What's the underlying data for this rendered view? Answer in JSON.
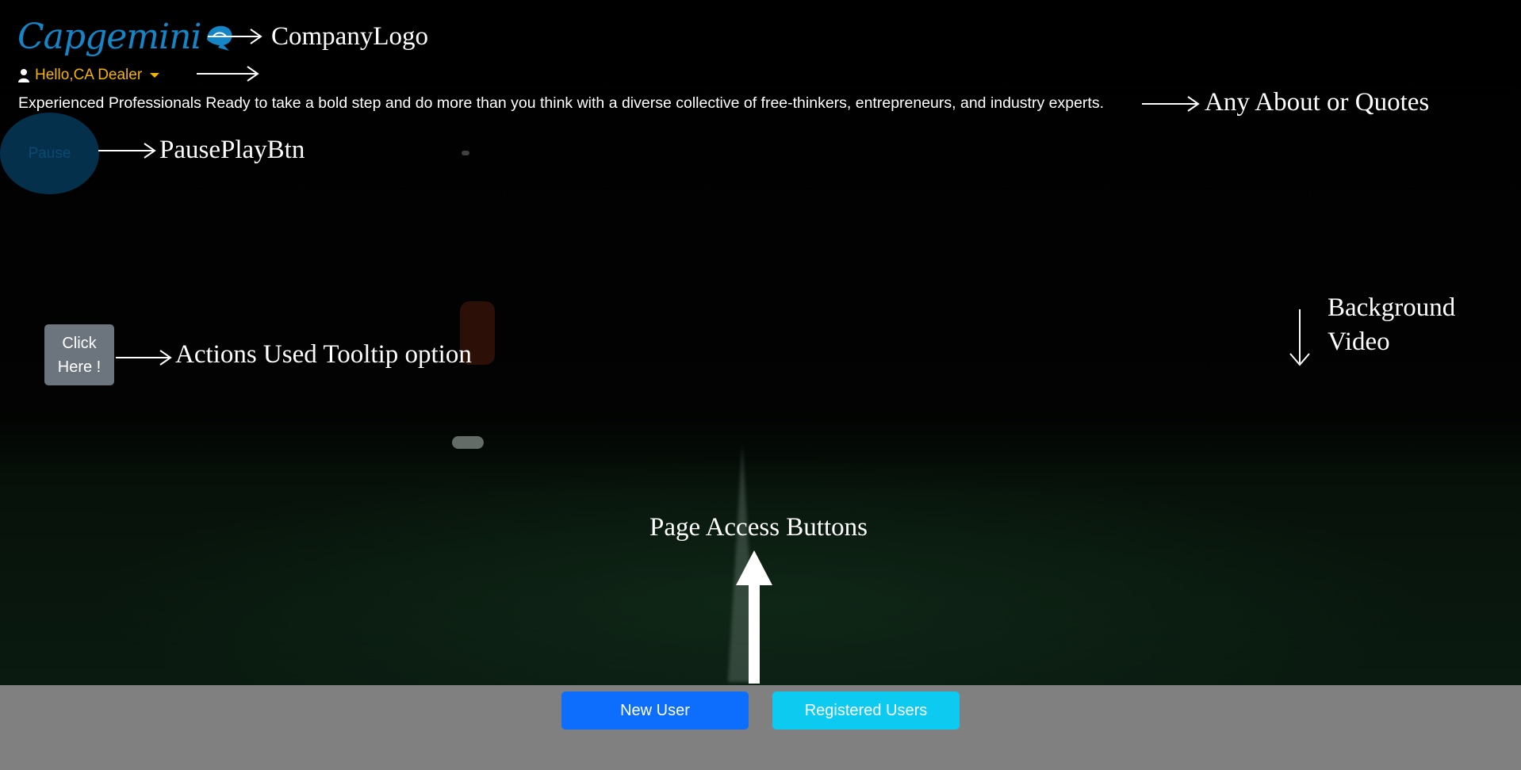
{
  "brand": {
    "logo_text": "Capgemini",
    "logo_color": "#1486c8"
  },
  "user_menu": {
    "greeting": "Hello,CA Dealer",
    "icon": "user-icon",
    "color": "#f4b400"
  },
  "about": {
    "text": "Experienced Professionals Ready to take a bold step and do more than you think with a diverse collective of free-thinkers, entrepreneurs, and industry experts."
  },
  "pause_button": {
    "label": "Pause"
  },
  "tooltip_button": {
    "line1": "Click",
    "line2": "Here !"
  },
  "page_access": {
    "new_user_label": "New User",
    "registered_users_label": "Registered Users",
    "new_user_color": "#0d6efd",
    "registered_users_color": "#0dcaf0"
  },
  "annotations": {
    "company_logo": "CompanyLogo",
    "about_quotes": "Any About or Quotes",
    "pause_play": "PausePlayBtn",
    "tooltip": "Actions Used Tooltip option",
    "background_line1": "Background",
    "background_line2": "Video",
    "page_access": "Page Access Buttons"
  }
}
